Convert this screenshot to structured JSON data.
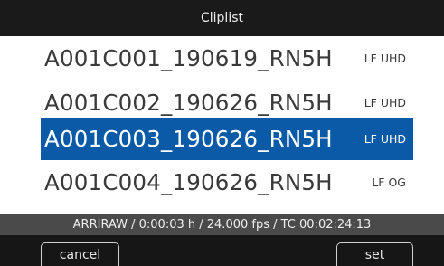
{
  "header": {
    "title": "Cliplist"
  },
  "clips": [
    {
      "name": "A001C001_190619_RN5H",
      "format": "LF UHD",
      "selected": false
    },
    {
      "name": "A001C002_190626_RN5H",
      "format": "LF UHD",
      "selected": false
    },
    {
      "name": "A001C003_190626_RN5H",
      "format": "LF UHD",
      "selected": true
    },
    {
      "name": "A001C004_190626_RN5H",
      "format": "LF OG",
      "selected": false
    }
  ],
  "status": {
    "text": "ARRIRAW / 0:00:03 h / 24.000 fps / TC 00:02:24:13"
  },
  "buttons": {
    "cancel_label": "cancel",
    "set_label": "set"
  },
  "colors": {
    "selection": "#0b5aa8",
    "list_background": "#ffffff",
    "status_background": "#4a4a4a"
  }
}
